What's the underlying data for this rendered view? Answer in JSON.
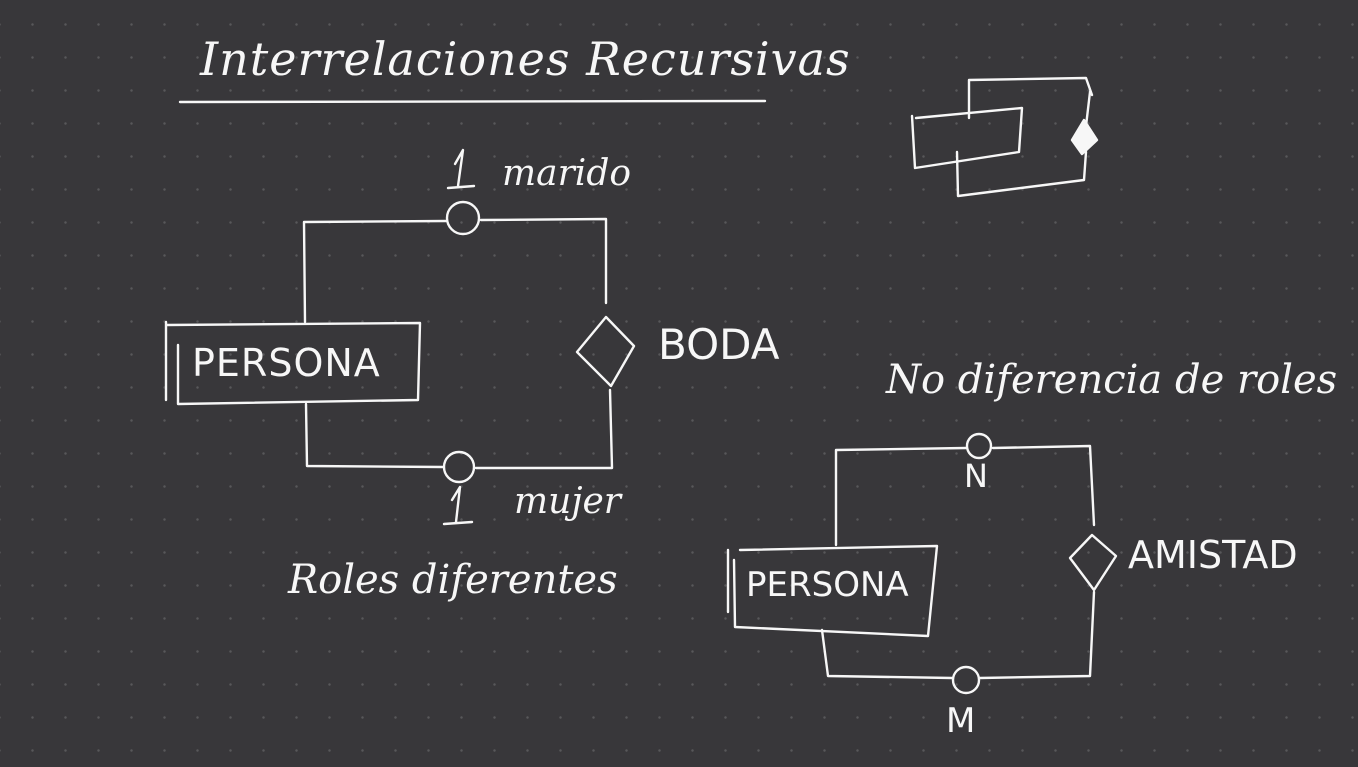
{
  "canvas": {
    "background": "#38373a",
    "ink": "#f7f7f7",
    "grid": "dotted"
  },
  "title": "Interrelaciones Recursivas",
  "diagram_left": {
    "entity": "PERSONA",
    "relationship": "BODA",
    "role_top_cardinality": "1",
    "role_top_name": "marido",
    "role_bottom_cardinality": "1",
    "role_bottom_name": "mujer",
    "caption": "Roles diferentes"
  },
  "diagram_right": {
    "caption": "No diferencia de roles",
    "entity": "PERSONA",
    "relationship": "AMISTAD",
    "cardinality_top": "N",
    "cardinality_bottom": "M"
  },
  "icons": {
    "top_right": "recursive-relationship-sketch-icon"
  }
}
